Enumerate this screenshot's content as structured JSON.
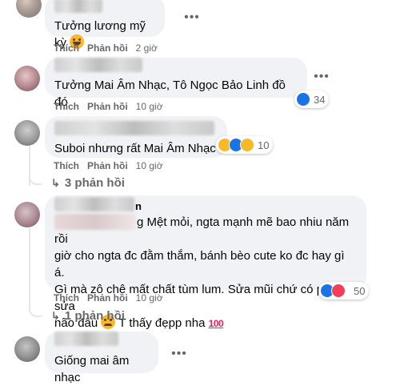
{
  "comments": [
    {
      "text": "Tưởng lương mỹ kỳ",
      "actions": {
        "like": "Thích",
        "reply": "Phản hồi",
        "time": "2 giờ"
      }
    },
    {
      "name": "Ngọc Hà",
      "text": "Tưởng Mai Âm Nhạc, Tô Ngọc Bảo Linh đồ đó",
      "actions": {
        "like": "Thích",
        "reply": "Phản hồi",
        "time": "10 giờ"
      },
      "reactions": {
        "count": "34"
      }
    },
    {
      "text": "Suboi nhưng rất Mai Âm Nhạc",
      "actions": {
        "like": "Thích",
        "reply": "Phản hồi",
        "time": "10 giờ"
      },
      "reactions": {
        "count": "10"
      },
      "replies_label": "3 phản hồi"
    },
    {
      "name_suffix": "n",
      "text_line1": "g Mệt mỏi, ngta mạnh mẽ bao nhiu năm rồi",
      "text_line2": "giờ cho ngta đc đằm thắm, bánh bèo cute ko đc hay gì á.",
      "text_line3": "Gì mà zô chê mất chất tùm lum. Sửa mũi chứ có phải sửa",
      "text_line4": "não đâu",
      "text_line4b": "T thấy đẹpp nha",
      "hundred": "100",
      "actions": {
        "like": "Thích",
        "reply": "Phản hồi",
        "time": "10 giờ"
      },
      "reactions": {
        "count": "50"
      },
      "replies_label": "1 phản hồi"
    },
    {
      "name": "Linh Trang",
      "text": "Giống mai âm nhạc"
    }
  ],
  "icons": [
    "more-options-icon",
    "like-reaction-icon",
    "love-reaction-icon",
    "haha-reaction-icon",
    "care-reaction-icon",
    "reply-arrow-icon"
  ],
  "colors": {
    "bubble": "#f0f2f5",
    "meta": "#65676b",
    "like": "#1b74e4",
    "love": "#f33e58",
    "haha": "#f7b928"
  }
}
